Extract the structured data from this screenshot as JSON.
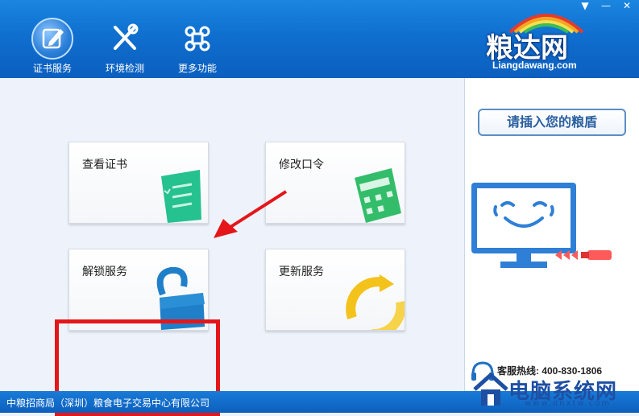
{
  "nav": {
    "items": [
      {
        "label": "证书服务",
        "icon": "certificate-edit-icon",
        "active": true
      },
      {
        "label": "环境检测",
        "icon": "tools-icon",
        "active": false
      },
      {
        "label": "更多功能",
        "icon": "command-icon",
        "active": false
      }
    ]
  },
  "window": {
    "menu": "▼",
    "minimize": "—",
    "close": "✕"
  },
  "brand": {
    "cn": "粮达网",
    "en": "Liangdawang.com"
  },
  "tiles": [
    {
      "title": "查看证书",
      "icon": "document-list-icon",
      "color": "#22c08a"
    },
    {
      "title": "修改口令",
      "icon": "calculator-icon",
      "color": "#2fbf6a"
    },
    {
      "title": "解锁服务",
      "icon": "unlock-icon",
      "color": "#1f7fc9"
    },
    {
      "title": "更新服务",
      "icon": "refresh-icon",
      "color": "#f3c31b"
    }
  ],
  "side": {
    "insert_prompt": "请插入您的粮盾",
    "hotline": "客服热线: 400-830-1806"
  },
  "footer": {
    "company": "中粮招商局（深圳）粮食电子交易中心有限公司"
  },
  "watermark": {
    "text": "电脑系统网",
    "url": "www.dnxtw.com"
  },
  "colors": {
    "accent": "#0f6fcf",
    "highlight": "#e4161a"
  }
}
